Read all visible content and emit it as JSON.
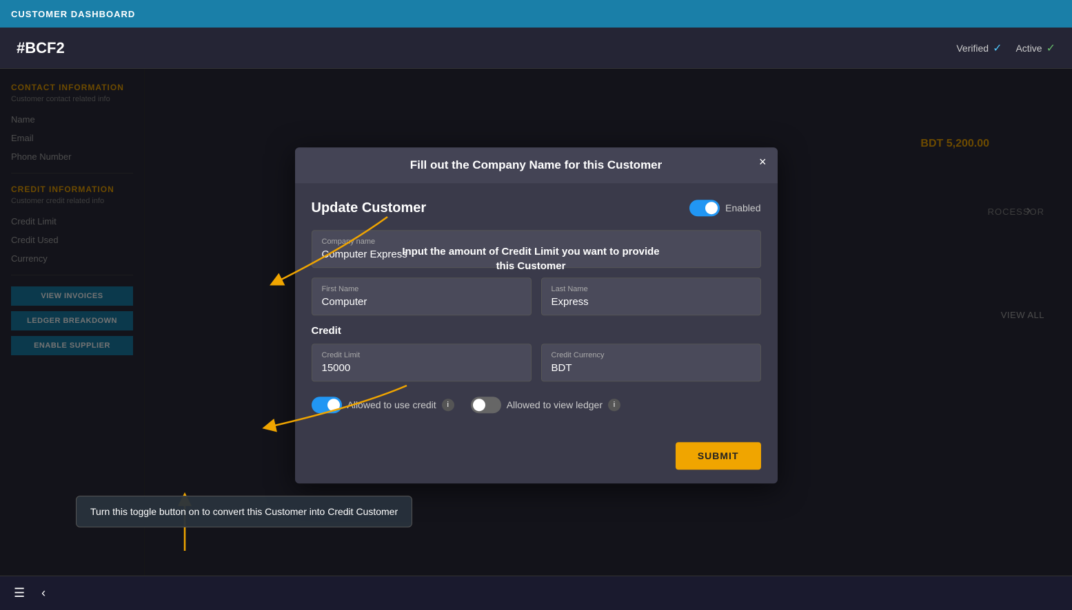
{
  "topBar": {
    "title": "CUSTOMER DASHBOARD"
  },
  "customerHeader": {
    "id": "#BCF2",
    "verified": "Verified",
    "active": "Active"
  },
  "leftPanel": {
    "contactSection": {
      "title": "CONTACT INFORMATION",
      "subtitle": "Customer contact related info",
      "fields": [
        "Name",
        "Email",
        "Phone Number"
      ]
    },
    "creditSection": {
      "title": "CREDIT INFORMATION",
      "subtitle": "Customer credit related info",
      "fields": [
        "Credit Limit",
        "Credit Used",
        "Currency"
      ]
    },
    "buttons": [
      "VIEW INVOICES",
      "LEDGER BREAKDOWN",
      "ENABLE SUPPLIER"
    ]
  },
  "rightPanel": {
    "bdtAmount": "BDT 5,200.00",
    "processorText": "ROCESSOR",
    "viewAll": "VIEW ALL"
  },
  "modal": {
    "headerTitle": "Fill out the Company Name for this Customer",
    "sectionTitle": "Update Customer",
    "enabledLabel": "Enabled",
    "closeBtn": "×",
    "companyField": {
      "label": "Company name",
      "value": "Computer Express"
    },
    "firstNameField": {
      "label": "First Name",
      "value": "Computer"
    },
    "lastNameField": {
      "label": "Last Name",
      "value": "Express"
    },
    "creditSectionLabel": "Credit",
    "creditLimitField": {
      "label": "Credit Limit",
      "value": "15000"
    },
    "creditCurrencyField": {
      "label": "Credit Currency",
      "value": "BDT"
    },
    "allowedUseCreditLabel": "Allowed to use credit",
    "allowedViewLedgerLabel": "Allowed to view ledger",
    "submitBtn": "SUBMIT"
  },
  "annotations": {
    "arrow1Tooltip": "Fill out the Company Name for this Customer",
    "arrow2Tooltip": "Input the amount of Credit Limit you want to provide this Customer",
    "bottomTooltip": "Turn this toggle button on to convert this Customer into Credit Customer"
  },
  "bottomBar": {
    "hamburger": "☰",
    "back": "‹"
  }
}
